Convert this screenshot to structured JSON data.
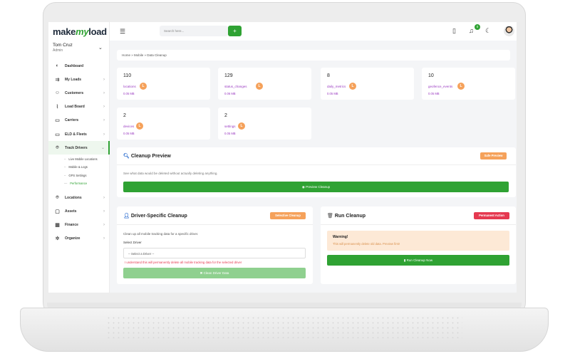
{
  "app": {
    "logo_prefix": "make",
    "logo_mid": "my",
    "logo_suffix": "load"
  },
  "user": {
    "name": "Tom Cruz",
    "role": "Admin"
  },
  "topbar": {
    "search_placeholder": "Search here...",
    "search_button": "+",
    "notification_count": "0"
  },
  "sidebar": {
    "items": [
      {
        "label": "Dashboard",
        "icon": "dashboard-icon",
        "glyph": "◐"
      },
      {
        "label": "My Loads",
        "icon": "truck-icon",
        "glyph": "⇉"
      },
      {
        "label": "Customers",
        "icon": "users-icon",
        "glyph": "☺"
      },
      {
        "label": "Load Board",
        "icon": "chart-icon",
        "glyph": "⌇"
      },
      {
        "label": "Carriers",
        "icon": "carrier-icon",
        "glyph": "▭"
      },
      {
        "label": "ELD & Fleets",
        "icon": "fleet-icon",
        "glyph": "▭"
      },
      {
        "label": "Track Drivers",
        "icon": "location-pin-icon",
        "glyph": "⌾"
      }
    ],
    "sub_items": [
      {
        "label": "Live Mobile Locations"
      },
      {
        "label": "Mobile & Logs"
      },
      {
        "label": "GPS Settings"
      },
      {
        "label": "Performance"
      }
    ],
    "items_after": [
      {
        "label": "Locations",
        "icon": "pin-icon",
        "glyph": "⌾"
      },
      {
        "label": "Assets",
        "icon": "lock-icon",
        "glyph": "▢"
      },
      {
        "label": "Finance",
        "icon": "calendar-icon",
        "glyph": "▦"
      },
      {
        "label": "Organize",
        "icon": "gear-icon",
        "glyph": "✲"
      }
    ]
  },
  "breadcrumb": "Home  »  Mobile  »  Data Cleanup",
  "stats": [
    {
      "num": "110",
      "label": "locations",
      "size": "0.05 MB"
    },
    {
      "num": "129",
      "label": "status_changes",
      "size": "0.06 MB"
    },
    {
      "num": "8",
      "label": "daily_metrics",
      "size": "0.05 MB"
    },
    {
      "num": "10",
      "label": "geofence_events",
      "size": "0.05 MB"
    },
    {
      "num": "2",
      "label": "devices",
      "size": "0.05 MB"
    },
    {
      "num": "2",
      "label": "settings",
      "size": "0.05 MB"
    }
  ],
  "stat_badge": "L",
  "preview": {
    "title": "Cleanup Preview",
    "badge": "Safe Preview",
    "description": "See what data would be deleted without actually deleting anything.",
    "button": "Preview Cleanup"
  },
  "driver": {
    "title": "Driver-Specific Cleanup",
    "badge": "Selective Cleanup",
    "description": "Clean up all mobile tracking data for a specific driver.",
    "select_label": "Select Driver",
    "select_value": "-- Select a Driver --",
    "warning": "I understand this will permanently delete all mobile tracking data for the selected driver",
    "button": "Clean Driver Data"
  },
  "run": {
    "title": "Run Cleanup",
    "badge": "Permanent Action",
    "warn_title": "Warning!",
    "warn_text": "This will permanently delete old data. Preview first!",
    "button": "Run Cleanup Now"
  },
  "colors": {
    "accent": "#2fa233",
    "stat_label": "#9b3cc2",
    "orange": "#f5a15a",
    "danger": "#e53950"
  }
}
